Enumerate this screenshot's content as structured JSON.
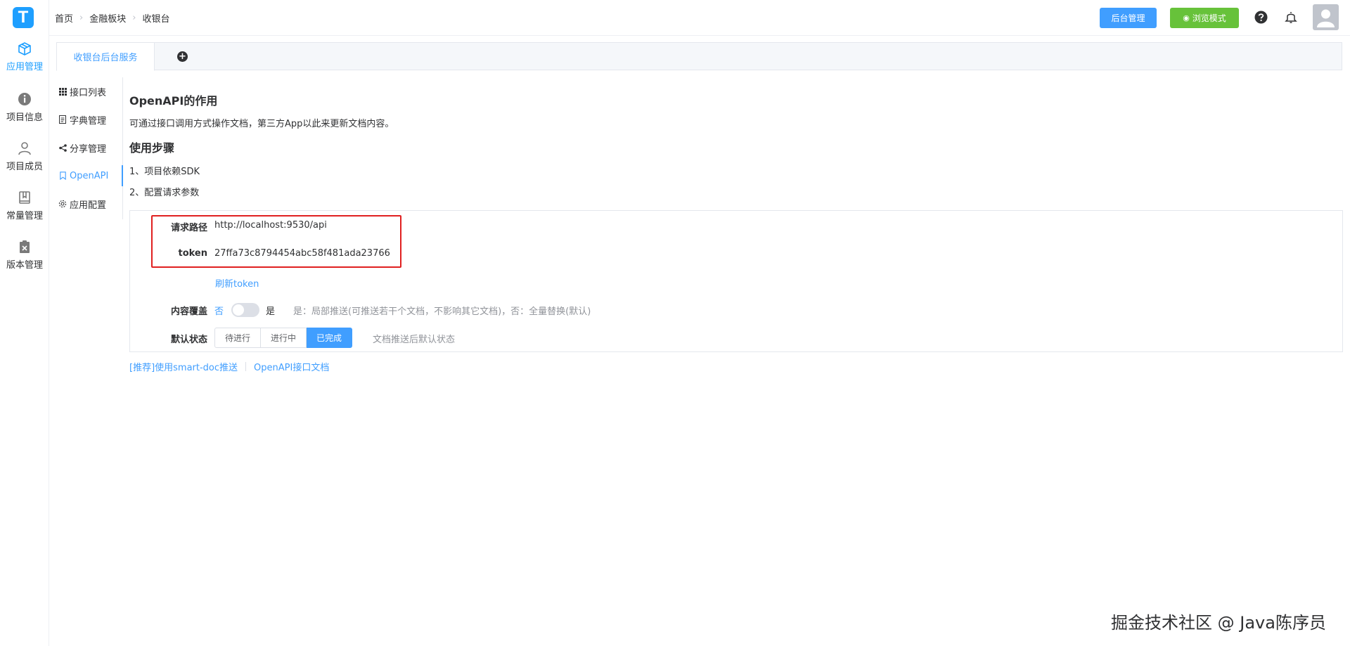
{
  "nav_rail": {
    "logo_letter": "T",
    "items": [
      {
        "label": "应用管理",
        "icon": "box-icon",
        "active": true
      },
      {
        "label": "项目信息",
        "icon": "info-icon",
        "active": false
      },
      {
        "label": "项目成员",
        "icon": "user-icon",
        "active": false
      },
      {
        "label": "常量管理",
        "icon": "book-icon",
        "active": false
      },
      {
        "label": "版本管理",
        "icon": "clipboard-icon",
        "active": false
      }
    ]
  },
  "header": {
    "breadcrumb": [
      "首页",
      "金融板块",
      "收银台"
    ],
    "admin_button": "后台管理",
    "browse_button": "浏览模式"
  },
  "tabs": {
    "active_tab": "收银台后台服务",
    "add_tab": "+"
  },
  "submenu": {
    "items": [
      {
        "label": "接口列表",
        "icon": "grid-icon",
        "active": false
      },
      {
        "label": "字典管理",
        "icon": "doc-icon",
        "active": false
      },
      {
        "label": "分享管理",
        "icon": "share-icon",
        "active": false
      },
      {
        "label": "OpenAPI",
        "icon": "bookmark-icon",
        "active": true
      },
      {
        "label": "应用配置",
        "icon": "gear-icon",
        "active": false
      }
    ]
  },
  "content": {
    "title": "OpenAPI的作用",
    "description": "可通过接口调用方式操作文档，第三方App以此来更新文档内容。",
    "steps_title": "使用步骤",
    "step1": "1、项目依赖SDK",
    "step2": "2、配置请求参数"
  },
  "form": {
    "path_label": "请求路径",
    "path_value": "http://localhost:9530/api",
    "token_label": "token",
    "token_value": "27ffa73c8794454abc58f481ada23766",
    "refresh_link": "刷新token",
    "override_label": "内容覆盖",
    "override_no": "否",
    "override_yes": "是",
    "override_on": false,
    "override_hint": "是：局部推送(可推送若干个文档，不影响其它文档)，否：全量替换(默认)",
    "status_label": "默认状态",
    "status_options": [
      "待进行",
      "进行中",
      "已完成"
    ],
    "status_selected": "已完成",
    "status_hint": "文档推送后默认状态"
  },
  "links": {
    "smart_doc": "[推荐]使用smart-doc推送",
    "openapi_doc": "OpenAPI接口文档"
  },
  "watermark": "掘金技术社区 @ Java陈序员",
  "colors": {
    "primary": "#409eff",
    "success": "#67c23a",
    "highlight_box": "#e02020"
  }
}
